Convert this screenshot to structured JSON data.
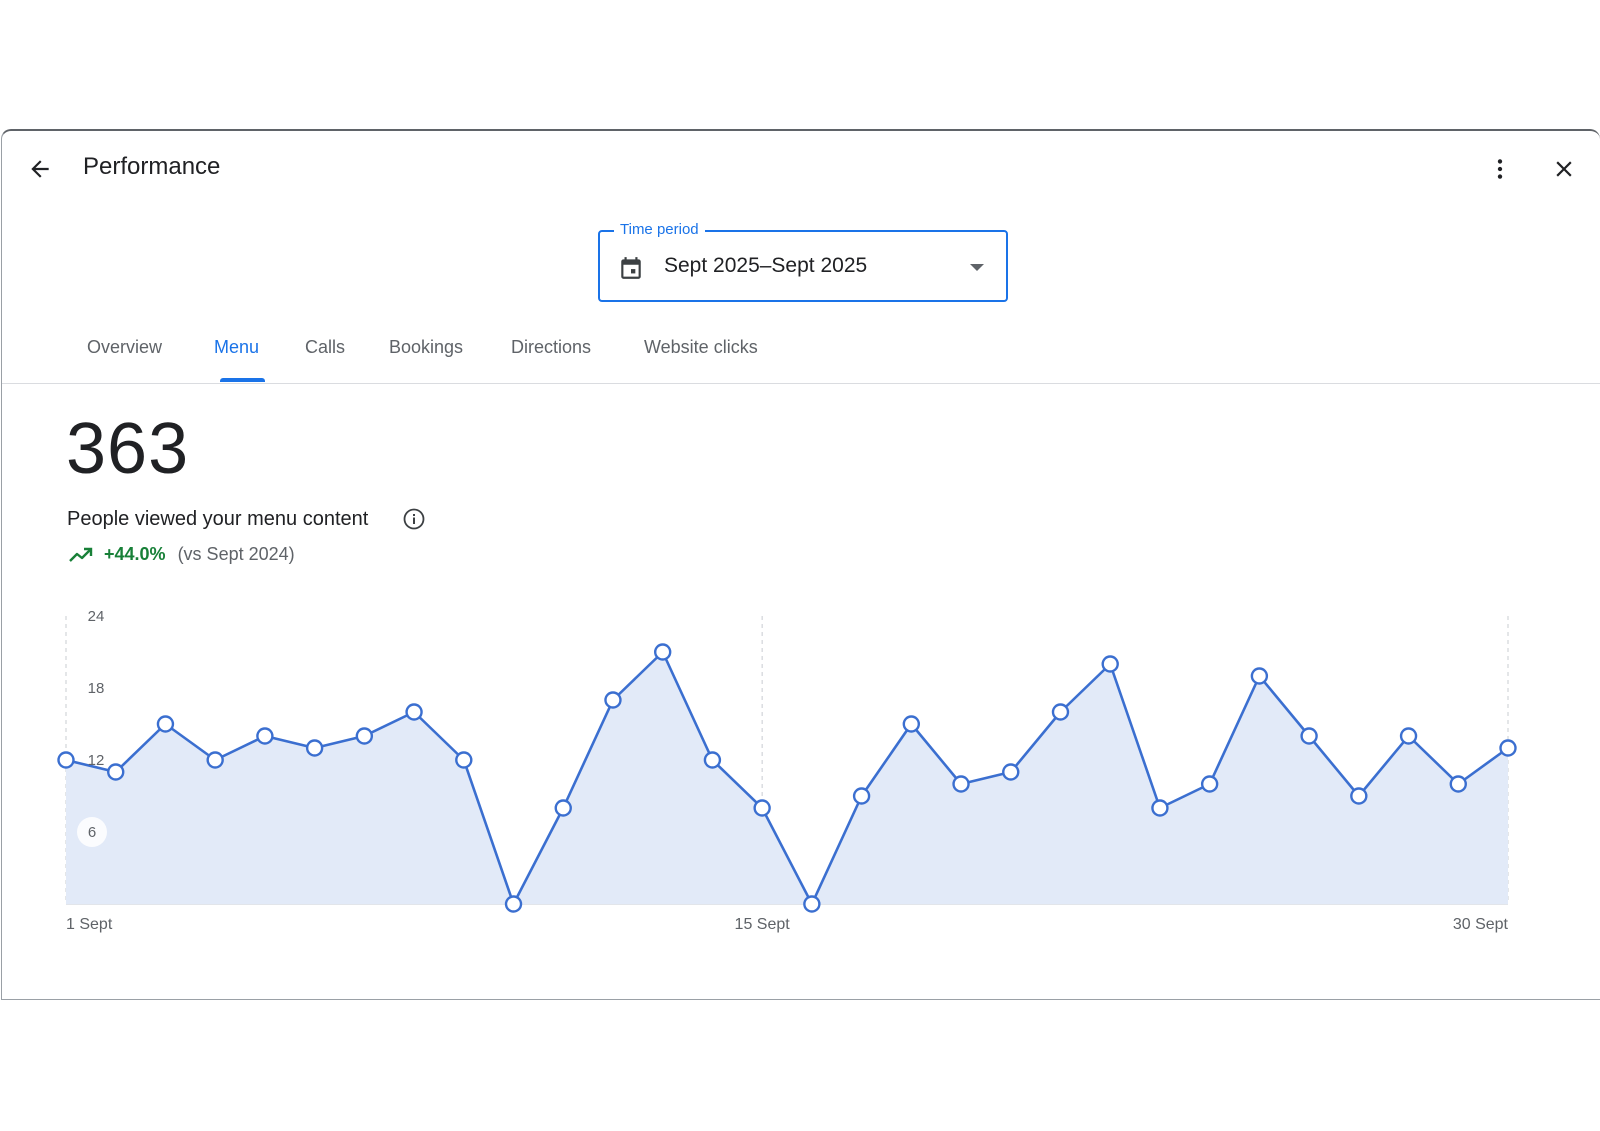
{
  "header": {
    "title": "Performance",
    "back_icon": "arrow-back-icon",
    "more_icon": "more-vert-icon",
    "close_icon": "close-icon"
  },
  "time_period": {
    "label": "Time period",
    "value": "Sept 2025–Sept 2025",
    "icon": "calendar-icon"
  },
  "tabs": [
    {
      "label": "Overview",
      "active": false
    },
    {
      "label": "Menu",
      "active": true
    },
    {
      "label": "Calls",
      "active": false
    },
    {
      "label": "Bookings",
      "active": false
    },
    {
      "label": "Directions",
      "active": false
    },
    {
      "label": "Website clicks",
      "active": false
    }
  ],
  "metric": {
    "value": "363",
    "label": "People viewed your menu content",
    "change": "+44.0%",
    "comparison": "(vs Sept 2024)"
  },
  "colors": {
    "accent": "#1a73e8",
    "line": "#3b6fd0",
    "area": "#e2eaf8",
    "positive": "#188038"
  },
  "chart_data": {
    "type": "area",
    "x_tick_labels": [
      "1 Sept",
      "15 Sept",
      "30 Sept"
    ],
    "y_ticks": [
      6,
      12,
      18,
      24
    ],
    "ylim": [
      0,
      24
    ],
    "grid": "vertical dashed lines at 1 Sept, 15 Sept and 30 Sept",
    "series": [
      {
        "x": [
          "1 Sept",
          "2 Sept",
          "3 Sept",
          "4 Sept",
          "5 Sept",
          "6 Sept",
          "7 Sept",
          "8 Sept",
          "9 Sept",
          "10 Sept",
          "11 Sept",
          "12 Sept",
          "13 Sept",
          "14 Sept",
          "15 Sept",
          "16 Sept",
          "17 Sept",
          "18 Sept",
          "19 Sept",
          "20 Sept",
          "21 Sept",
          "22 Sept",
          "23 Sept",
          "24 Sept",
          "25 Sept",
          "26 Sept",
          "27 Sept",
          "28 Sept",
          "29 Sept",
          "30 Sept"
        ],
        "values": [
          12,
          11,
          15,
          12,
          14,
          13,
          14,
          16,
          12,
          0,
          8,
          17,
          21,
          12,
          8,
          0,
          9,
          15,
          10,
          11,
          16,
          20,
          8,
          10,
          19,
          14,
          9,
          14,
          10,
          13
        ]
      }
    ]
  }
}
